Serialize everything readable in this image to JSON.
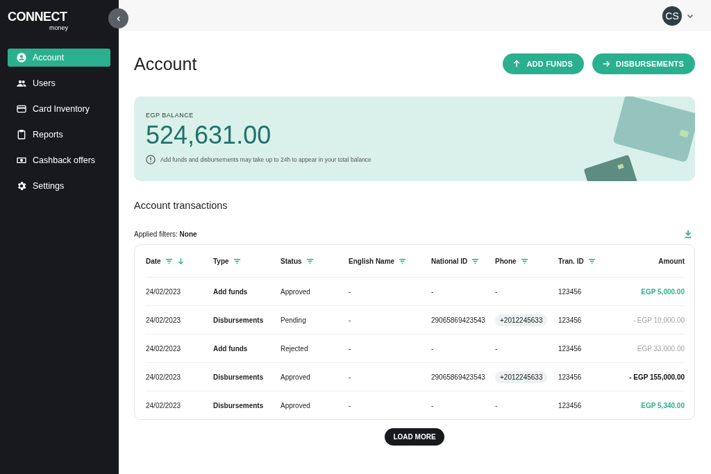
{
  "logo": {
    "name": "CONNECT",
    "tagline": "money"
  },
  "sidebar": {
    "items": [
      {
        "label": "Account",
        "selected": true
      },
      {
        "label": "Users",
        "selected": false
      },
      {
        "label": "Card Inventory",
        "selected": false
      },
      {
        "label": "Reports",
        "selected": false
      },
      {
        "label": "Cashback offers",
        "selected": false
      },
      {
        "label": "Settings",
        "selected": false
      }
    ]
  },
  "user": {
    "initials": "CS"
  },
  "page_title": "Account",
  "actions": [
    {
      "label": "ADD FUNDS",
      "kind": "up"
    },
    {
      "label": "DISBURSEMENTS",
      "kind": "right"
    }
  ],
  "balance": {
    "label": "EGP BALANCE",
    "amount": "524,631.00",
    "note": "Add funds and disbursements may take up to 24h to appear in your total balance"
  },
  "transactions": {
    "title": "Account transactions",
    "filters_label": "Applied filters:",
    "filters_value": "None",
    "columns": [
      {
        "label": "Date",
        "filter": true,
        "sorted": true
      },
      {
        "label": "Type",
        "filter": true,
        "sorted": false
      },
      {
        "label": "Status",
        "filter": true,
        "sorted": false
      },
      {
        "label": "English Name",
        "filter": true,
        "sorted": false
      },
      {
        "label": "National ID",
        "filter": true,
        "sorted": false
      },
      {
        "label": "Phone",
        "filter": true,
        "sorted": false
      },
      {
        "label": "Tran. ID",
        "filter": true,
        "sorted": false
      },
      {
        "label": "Amount",
        "filter": false,
        "sorted": false
      }
    ],
    "rows": [
      {
        "date": "24/02/2023",
        "type": "Add funds",
        "status": "Approved",
        "english_name": "-",
        "national_id": "-",
        "phone": "-",
        "tran_id": "123456",
        "amount": "EGP 5,000.00",
        "kind": "credit"
      },
      {
        "date": "24/02/2023",
        "type": "Disbursements",
        "status": "Pending",
        "english_name": "-",
        "national_id": "29065869423543",
        "phone": "+2012245633",
        "tran_id": "123456",
        "amount": "- EGP 10,000.00",
        "kind": "muted"
      },
      {
        "date": "24/02/2023",
        "type": "Add funds",
        "status": "Rejected",
        "english_name": "-",
        "national_id": "-",
        "phone": "-",
        "tran_id": "123456",
        "amount": "EGP 33,000.00",
        "kind": "muted"
      },
      {
        "date": "24/02/2023",
        "type": "Disbursements",
        "status": "Approved",
        "english_name": "-",
        "national_id": "29065869423543",
        "phone": "+2012245633",
        "tran_id": "123456",
        "amount": "- EGP 155,000.00",
        "kind": "debit"
      },
      {
        "date": "24/02/2023",
        "type": "Disbursements",
        "status": "Approved",
        "english_name": "-",
        "national_id": "-",
        "phone": "-",
        "tran_id": "123456",
        "amount": "EGP 5,340.00",
        "kind": "credit"
      }
    ],
    "load_more": "LOAD MORE"
  }
}
